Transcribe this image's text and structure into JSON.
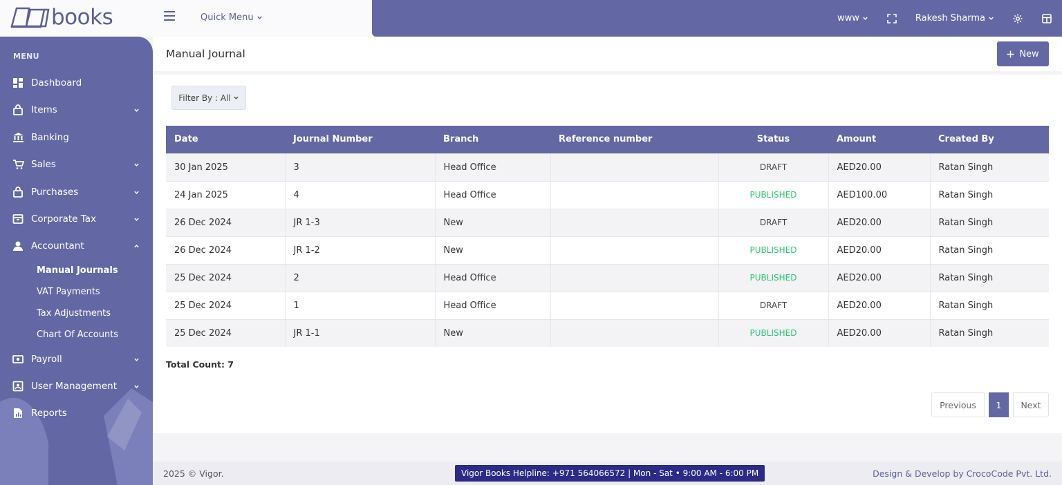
{
  "brand": {
    "logo_text": "books"
  },
  "header": {
    "quick_menu": "Quick Menu",
    "workspace": "www",
    "user_name": "Rakesh Sharma"
  },
  "sidebar": {
    "menu_heading": "MENU",
    "items": [
      {
        "label": "Dashboard",
        "icon": "dashboard-icon"
      },
      {
        "label": "Items",
        "icon": "bag-icon"
      },
      {
        "label": "Banking",
        "icon": "bank-icon"
      },
      {
        "label": "Sales",
        "icon": "cart-icon"
      },
      {
        "label": "Purchases",
        "icon": "bag-icon"
      },
      {
        "label": "Corporate Tax",
        "icon": "archive-icon"
      },
      {
        "label": "Accountant",
        "icon": "user-icon"
      },
      {
        "label": "Payroll",
        "icon": "money-icon"
      },
      {
        "label": "User Management",
        "icon": "user-card-icon"
      },
      {
        "label": "Reports",
        "icon": "report-icon"
      }
    ],
    "sub_items": [
      "Manual Journals",
      "VAT Payments",
      "Tax Adjustments",
      "Chart Of Accounts"
    ]
  },
  "page": {
    "title": "Manual Journal",
    "new_button": "New",
    "filter_label": "Filter By : All"
  },
  "table": {
    "columns": [
      "Date",
      "Journal Number",
      "Branch",
      "Reference number",
      "Status",
      "Amount",
      "Created By"
    ],
    "rows": [
      {
        "date": "30 Jan 2025",
        "number": "3",
        "branch": "Head Office",
        "reference": "",
        "status": "DRAFT",
        "amount": "AED20.00",
        "created_by": "Ratan Singh"
      },
      {
        "date": "24 Jan 2025",
        "number": "4",
        "branch": "Head Office",
        "reference": "",
        "status": "PUBLISHED",
        "amount": "AED100.00",
        "created_by": "Ratan Singh"
      },
      {
        "date": "26 Dec 2024",
        "number": "JR 1-3",
        "branch": "New",
        "reference": "",
        "status": "DRAFT",
        "amount": "AED20.00",
        "created_by": "Ratan Singh"
      },
      {
        "date": "26 Dec 2024",
        "number": "JR 1-2",
        "branch": "New",
        "reference": "",
        "status": "PUBLISHED",
        "amount": "AED20.00",
        "created_by": "Ratan Singh"
      },
      {
        "date": "25 Dec 2024",
        "number": "2",
        "branch": "Head Office",
        "reference": "",
        "status": "PUBLISHED",
        "amount": "AED20.00",
        "created_by": "Ratan Singh"
      },
      {
        "date": "25 Dec 2024",
        "number": "1",
        "branch": "Head Office",
        "reference": "",
        "status": "DRAFT",
        "amount": "AED20.00",
        "created_by": "Ratan Singh"
      },
      {
        "date": "25 Dec 2024",
        "number": "JR 1-1",
        "branch": "New",
        "reference": "",
        "status": "PUBLISHED",
        "amount": "AED20.00",
        "created_by": "Ratan Singh"
      }
    ],
    "total_count": "Total Count: 7"
  },
  "pagination": {
    "previous": "Previous",
    "current": "1",
    "next": "Next"
  },
  "footer": {
    "copyright": "2025 © Vigor.",
    "helpline": "Vigor Books Helpline: +971 564066572 | Mon - Sat • 9:00 AM - 6:00 PM",
    "credit": "Design & Develop by CrocoCode Pvt. Ltd."
  },
  "colors": {
    "primary": "#6367a3",
    "published": "#28c76f",
    "helpline_bg": "#2b2a86"
  }
}
